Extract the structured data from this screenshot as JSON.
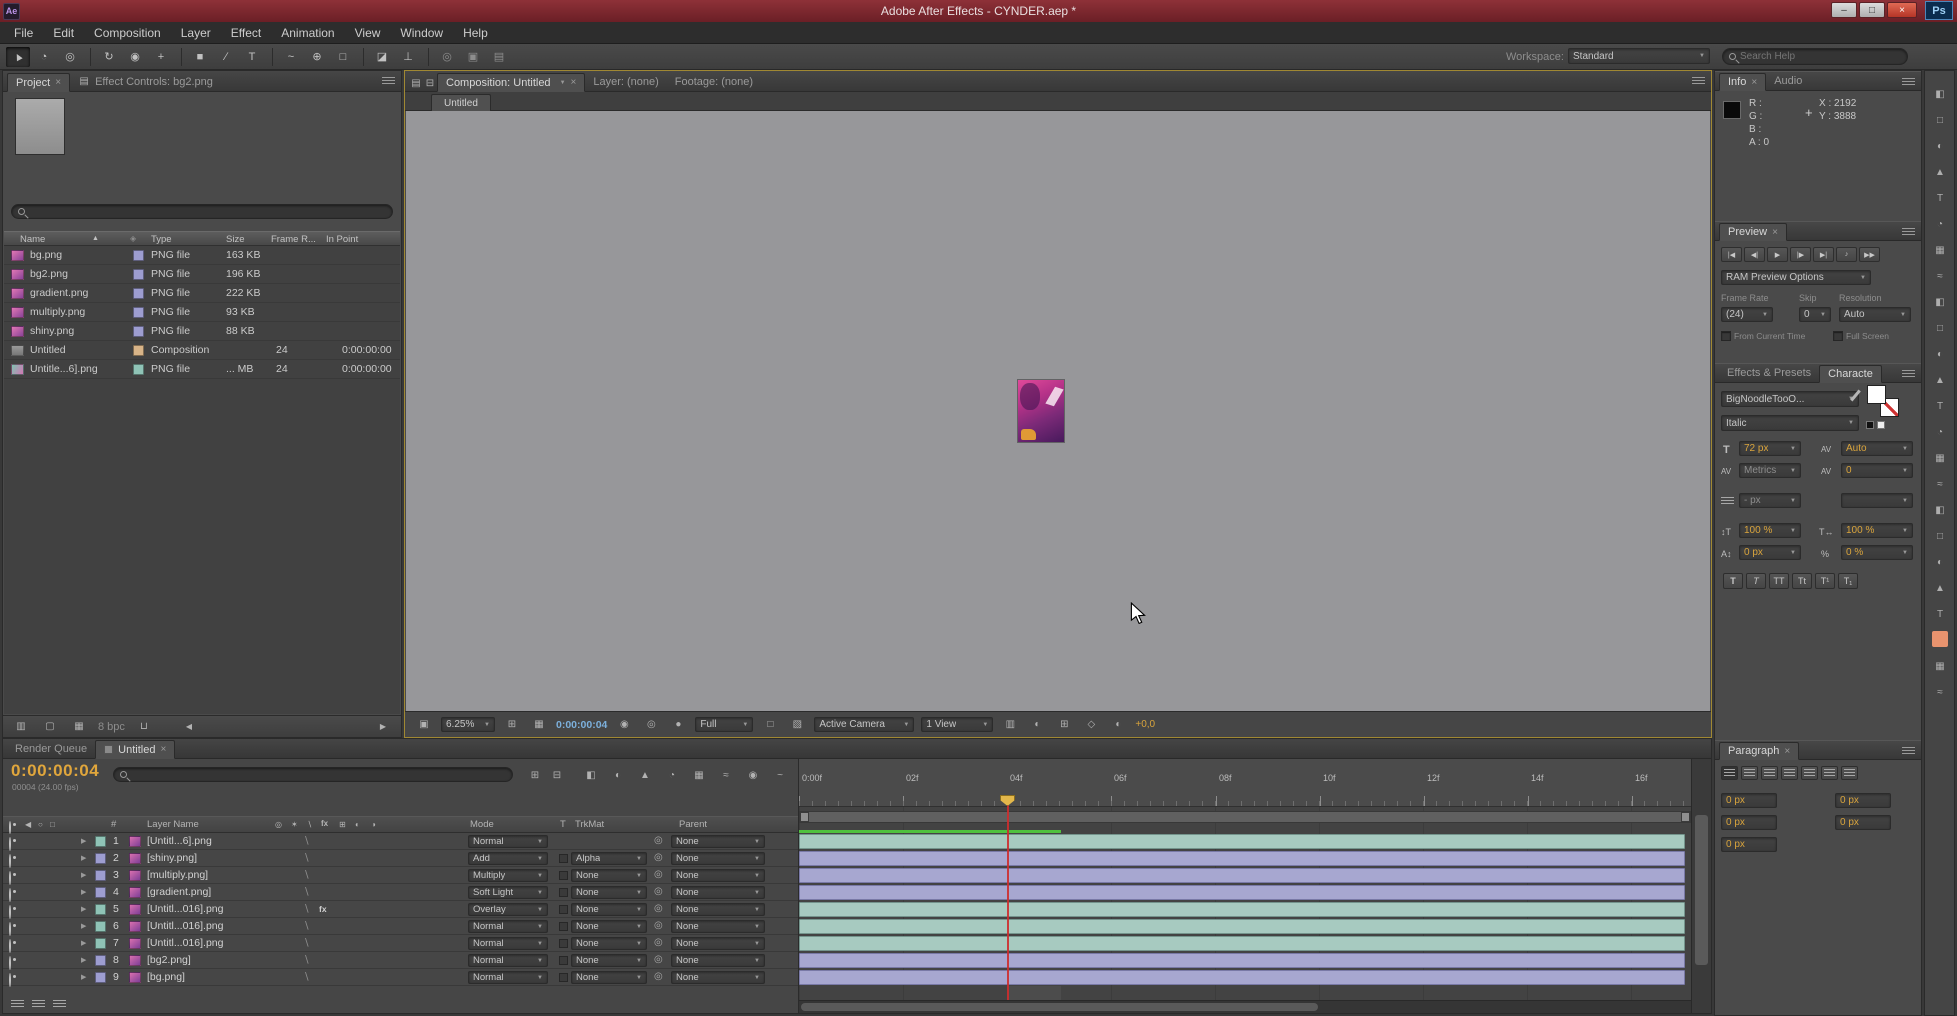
{
  "window": {
    "title": "Adobe After Effects - CYNDER.aep *",
    "app_badge": "Ae",
    "ps_badge": "Ps"
  },
  "menus": [
    "File",
    "Edit",
    "Composition",
    "Layer",
    "Effect",
    "Animation",
    "View",
    "Window",
    "Help"
  ],
  "topbar": {
    "workspace_label": "Workspace:",
    "workspace_value": "Standard",
    "search_placeholder": "Search Help"
  },
  "project": {
    "tab_project": "Project",
    "tab_effect_controls": "Effect Controls: bg2.png",
    "col_name": "Name",
    "col_type": "Type",
    "col_size": "Size",
    "col_frame": "Frame R...",
    "col_in": "In Point",
    "items": [
      {
        "name": "bg.png",
        "type": "PNG file",
        "size": "163 KB",
        "frame": "",
        "in": ""
      },
      {
        "name": "bg2.png",
        "type": "PNG file",
        "size": "196 KB",
        "frame": "",
        "in": ""
      },
      {
        "name": "gradient.png",
        "type": "PNG file",
        "size": "222 KB",
        "frame": "",
        "in": ""
      },
      {
        "name": "multiply.png",
        "type": "PNG file",
        "size": "93 KB",
        "frame": "",
        "in": ""
      },
      {
        "name": "shiny.png",
        "type": "PNG file",
        "size": "88 KB",
        "frame": "",
        "in": ""
      },
      {
        "name": "Untitled",
        "type": "Composition",
        "size": "",
        "frame": "24",
        "in": "0:00:00:00"
      },
      {
        "name": "Untitle...6].png",
        "type": "PNG file",
        "size": "... MB",
        "frame": "24",
        "in": "0:00:00:00"
      }
    ],
    "bit_depth": "8 bpc"
  },
  "viewer": {
    "tab_composition": "Composition: Untitled",
    "tab_layer": "Layer: (none)",
    "tab_footage": "Footage: (none)",
    "comp_tab": "Untitled",
    "zoom": "6.25%",
    "timecode": "0:00:00:04",
    "resolution": "Full",
    "camera": "Active Camera",
    "view_layout": "1 View",
    "exposure": "+0,0"
  },
  "info": {
    "tab_info": "Info",
    "tab_audio": "Audio",
    "r": "R :",
    "g": "G :",
    "b": "B :",
    "a": "A : 0",
    "x": "X : 2192",
    "y": "Y : 3888"
  },
  "preview": {
    "tab": "Preview",
    "ram_options": "RAM Preview Options",
    "frame_rate_label": "Frame Rate",
    "skip_label": "Skip",
    "resolution_label": "Resolution",
    "frame_rate_value": "(24)",
    "skip_value": "0",
    "resolution_value": "Auto",
    "from_current_time": "From Current Time",
    "full_screen": "Full Screen"
  },
  "character": {
    "tab_effects": "Effects & Presets",
    "tab_character": "Characte",
    "font_family": "BigNoodleTooO...",
    "font_style": "Italic",
    "font_size": "72 px",
    "kerning": "Auto",
    "tracking_mode": "Metrics",
    "tracking_value": "0",
    "stroke_width": "- px",
    "stroke_style": "",
    "vertical_scale": "100 %",
    "horizontal_scale": "100 %",
    "baseline_shift": "0 px",
    "tsume": "0 %"
  },
  "paragraph": {
    "tab": "Paragraph",
    "indent_left": "0 px",
    "indent_right": "0 px",
    "space_before": "0 px",
    "space_after": "0 px",
    "first_line_indent": "0 px"
  },
  "timeline": {
    "tab_render_queue": "Render Queue",
    "tab_comp": "Untitled",
    "timecode": "0:00:00:04",
    "frame_info": "00004 (24.00 fps)",
    "col_layer_name": "Layer Name",
    "col_mode": "Mode",
    "col_t": "T",
    "col_trkmat": "TrkMat",
    "col_parent": "Parent",
    "fx_badge": "fx",
    "layers": [
      {
        "num": "1",
        "name": "[Untitl...6].png",
        "mode": "Normal",
        "trkmat": "",
        "parent": "None",
        "label_color": "teal"
      },
      {
        "num": "2",
        "name": "[shiny.png]",
        "mode": "Add",
        "trkmat": "Alpha",
        "parent": "None",
        "label_color": "lavender"
      },
      {
        "num": "3",
        "name": "[multiply.png]",
        "mode": "Multiply",
        "trkmat": "None",
        "parent": "None",
        "label_color": "lavender"
      },
      {
        "num": "4",
        "name": "[gradient.png]",
        "mode": "Soft Light",
        "trkmat": "None",
        "parent": "None",
        "label_color": "lavender"
      },
      {
        "num": "5",
        "name": "[Untitl...016].png",
        "mode": "Overlay",
        "trkmat": "None",
        "parent": "None",
        "label_color": "teal"
      },
      {
        "num": "6",
        "name": "[Untitl...016].png",
        "mode": "Normal",
        "trkmat": "None",
        "parent": "None",
        "label_color": "teal"
      },
      {
        "num": "7",
        "name": "[Untitl...016].png",
        "mode": "Normal",
        "trkmat": "None",
        "parent": "None",
        "label_color": "teal"
      },
      {
        "num": "8",
        "name": "[bg2.png]",
        "mode": "Normal",
        "trkmat": "None",
        "parent": "None",
        "label_color": "lavender"
      },
      {
        "num": "9",
        "name": "[bg.png]",
        "mode": "Normal",
        "trkmat": "None",
        "parent": "None",
        "label_color": "lavender"
      }
    ],
    "ruler": [
      "0:00f",
      "02f",
      "04f",
      "06f",
      "08f",
      "10f",
      "12f",
      "14f",
      "16f"
    ]
  },
  "colors": {
    "titlebar_red": "#7c2a30",
    "accent_orange": "#d9a43c",
    "timecode_blue": "#7cb0dc",
    "bar_teal": "#a7cac0",
    "bar_lavender": "#a7a7d0",
    "playhead_red": "#c83232",
    "render_green": "#4fc13e"
  }
}
